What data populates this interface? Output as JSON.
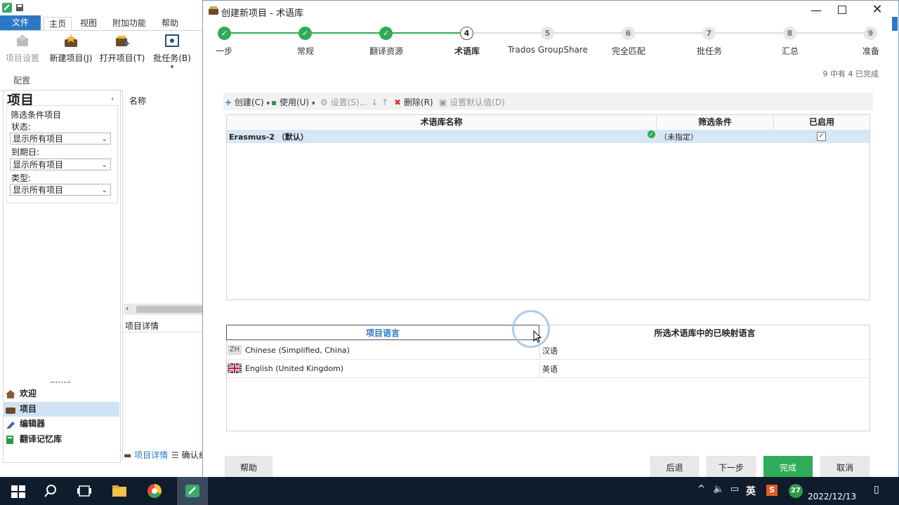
{
  "app": {
    "tabs": [
      "文件",
      "主页",
      "视图",
      "附加功能",
      "帮助"
    ],
    "ribbon": {
      "buttons": [
        "项目设置",
        "新建项目(J)",
        "打开项目(T)",
        "批任务(B)"
      ],
      "group_label": "配置"
    },
    "left_panel": {
      "title": "项目",
      "filter_label": "筛选条件项目",
      "filters": [
        {
          "label": "状态:",
          "value": "显示所有项目"
        },
        {
          "label": "到期日:",
          "value": "显示所有项目"
        },
        {
          "label": "类型:",
          "value": "显示所有项目"
        }
      ],
      "nav": [
        "欢迎",
        "项目",
        "编辑器",
        "翻译记忆库"
      ]
    },
    "mid_panel": {
      "column": "名称",
      "details_header": "项目详情",
      "bottom_tabs": [
        "项目详情",
        "确认纟"
      ]
    }
  },
  "dialog": {
    "title": "创建新项目 - 术语库",
    "steps": [
      {
        "num": "1",
        "label": "一步",
        "state": "done"
      },
      {
        "num": "2",
        "label": "常规",
        "state": "done"
      },
      {
        "num": "3",
        "label": "翻译资源",
        "state": "done"
      },
      {
        "num": "4",
        "label": "术语库",
        "state": "current"
      },
      {
        "num": "5",
        "label": "Trados GroupShare",
        "state": "todo"
      },
      {
        "num": "6",
        "label": "完全匹配",
        "state": "todo"
      },
      {
        "num": "7",
        "label": "批任务",
        "state": "todo"
      },
      {
        "num": "8",
        "label": "汇总",
        "state": "todo"
      },
      {
        "num": "9",
        "label": "准备",
        "state": "todo"
      }
    ],
    "progress": "9 中有 4 已完成",
    "toolbar": {
      "create": "创建(C)",
      "use": "使用(U)",
      "settings": "设置(S)...",
      "delete": "删除(R)",
      "set_default": "设置默认值(D)"
    },
    "termbase_table": {
      "headers": [
        "术语库名称",
        "筛选条件",
        "已启用"
      ],
      "rows": [
        {
          "name": "Erasmus-2 （默认）",
          "filter": "（未指定）",
          "enabled": true
        }
      ]
    },
    "language_table": {
      "headers": [
        "项目语言",
        "所选术语库中的已映射语言"
      ],
      "rows": [
        {
          "flag": "ZH",
          "language": "Chinese (Simplified, China)",
          "mapped": "汉语"
        },
        {
          "flag": "GB",
          "language": "English (United Kingdom)",
          "mapped": "英语"
        }
      ]
    },
    "buttons": {
      "help": "帮助",
      "back": "后退",
      "next": "下一步",
      "finish": "完成",
      "cancel": "取消"
    },
    "colors": {
      "accent": "#2eac57",
      "selection": "#d8e7f6",
      "header_blue": "#2a78c0"
    }
  },
  "taskbar": {
    "ime": "英",
    "badge": "27",
    "date": "2022/12/13"
  }
}
